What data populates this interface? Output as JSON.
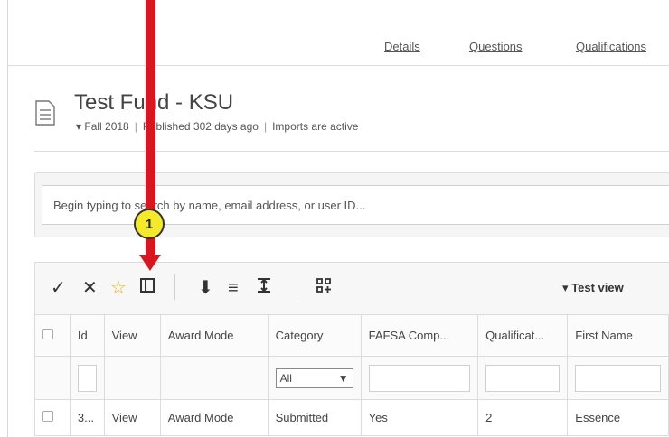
{
  "tabs": [
    "Details",
    "Questions",
    "Qualifications"
  ],
  "title": "Test Fund - KSU",
  "subtitle": {
    "term": "Fall 2018",
    "published": "Published 302 days ago",
    "imports": "Imports are active"
  },
  "search": {
    "placeholder": "Begin typing to search by name, email address, or user ID..."
  },
  "toolbar": {
    "view_selector": "Test view",
    "icons": [
      "check-icon",
      "x-icon",
      "star-icon",
      "columns-icon",
      "download-icon",
      "list-icon",
      "expand-icon",
      "grid-add-icon"
    ]
  },
  "table": {
    "columns": [
      "Id",
      "View",
      "Award Mode",
      "Category",
      "FAFSA Comp...",
      "Qualificat...",
      "First Name"
    ],
    "filter_category_value": "All",
    "rows": [
      {
        "id": "3...",
        "view": "View",
        "award_mode": "Award Mode",
        "category": "Submitted",
        "fafsa": "Yes",
        "qualifications": "2",
        "first_name": "Essence"
      }
    ]
  },
  "annotation": {
    "step_number": "1"
  },
  "colors": {
    "link": "#2c6ea5",
    "annotation_arrow": "#d9161f",
    "annotation_badge": "#f4ea2a"
  }
}
